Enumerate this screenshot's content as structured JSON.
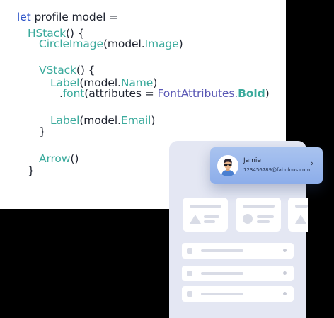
{
  "code": {
    "l1": {
      "kw": "let",
      "rest": " profile model ="
    },
    "l2": {
      "fn": "HStack",
      "rest": "() {"
    },
    "l3": {
      "fn": "CircleImage",
      "open": "(model.",
      "prop": "Image",
      "close": ")"
    },
    "l5": {
      "fn": "VStack",
      "rest": "() {"
    },
    "l6": {
      "fn": "Label",
      "open": "(model.",
      "prop": "Name",
      "close": ")"
    },
    "l7": {
      "dot": ".",
      "fn": "font",
      "open": "(attributes = ",
      "enum": "FontAttributes.",
      "val": "Bold",
      "close": ")"
    },
    "l9": {
      "fn": "Label",
      "open": "(model.",
      "prop": "Email",
      "close": ")"
    },
    "l10": {
      "brace": "}"
    },
    "l12": {
      "fn": "Arrow",
      "rest": "()"
    },
    "l13": {
      "brace": "}"
    }
  },
  "profile_card": {
    "name": "Jamie",
    "email": "123456789@fabulous.com",
    "chevron": "›"
  },
  "colors": {
    "keyword": "#2f55c8",
    "type": "#3aaa9c",
    "enum": "#5a58b5",
    "card_gradient_top": "#a9c3ef",
    "card_gradient_bottom": "#8cadea",
    "phone_bg": "#e4e7f3"
  }
}
